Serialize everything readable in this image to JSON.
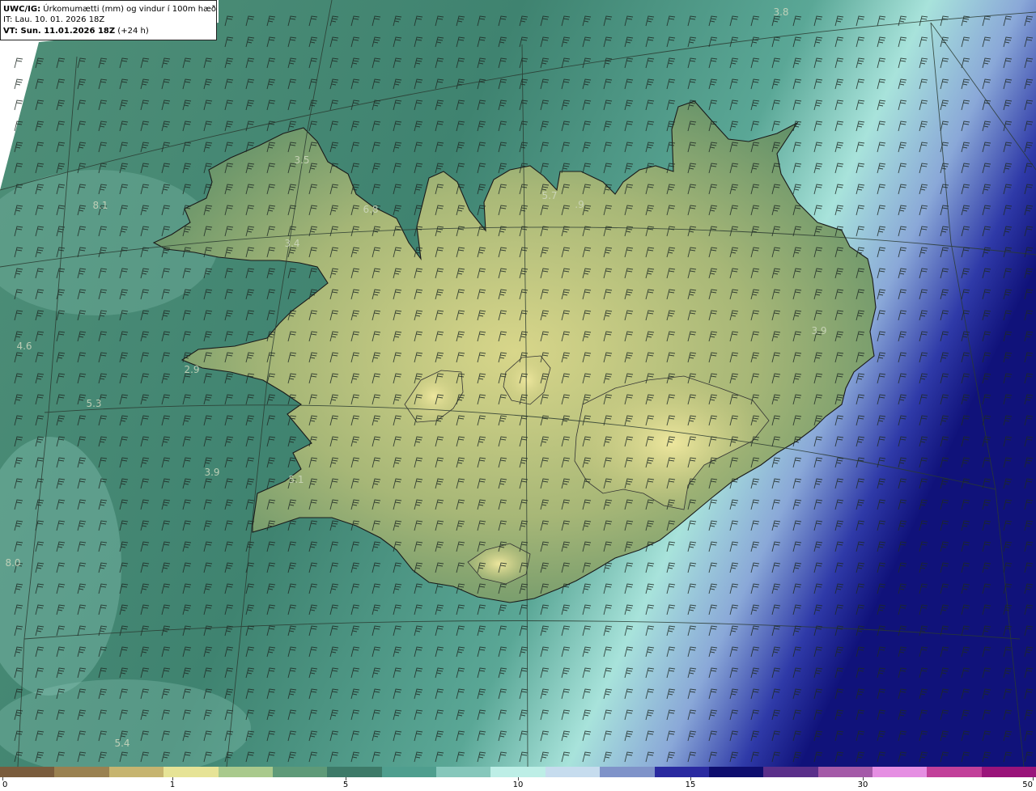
{
  "header": {
    "model_label": "UWC/IG:",
    "title_text": " Úrkomumætti (mm) og vindur í 100m hæð",
    "it_line": "IT: Lau. 10. 01. 2026 18Z",
    "vt_label": "VT: Sun. 11.01.2026 18Z",
    "vt_suffix": " (+24 h)"
  },
  "map_values": [
    {
      "text": "3.8"
    },
    {
      "text": "3.5"
    },
    {
      "text": "5.7"
    },
    {
      "text": ".9"
    },
    {
      "text": "8.1"
    },
    {
      "text": "6.8"
    },
    {
      "text": "3.4"
    },
    {
      "text": "4.6"
    },
    {
      "text": "3.9"
    },
    {
      "text": "2.9"
    },
    {
      "text": "5.3"
    },
    {
      "text": "3.9"
    },
    {
      "text": "5.1"
    },
    {
      "text": "8.0"
    },
    {
      "text": "5.4"
    }
  ],
  "colorbar": {
    "ticks": [
      "0",
      "1",
      "5",
      "10",
      "15",
      "30",
      "50"
    ],
    "colors": [
      "#7a5c3c",
      "#9a8150",
      "#c6b46f",
      "#e6e396",
      "#a9c98c",
      "#5e9a78",
      "#3d7a68",
      "#4f9e8e",
      "#86c7bb",
      "#bdeee6",
      "#c6dcee",
      "#7f93c9",
      "#2a2aa0",
      "#0e0e6e",
      "#5a2f8a",
      "#a45aa8",
      "#e58ee2",
      "#c2409a",
      "#9a147a"
    ]
  }
}
